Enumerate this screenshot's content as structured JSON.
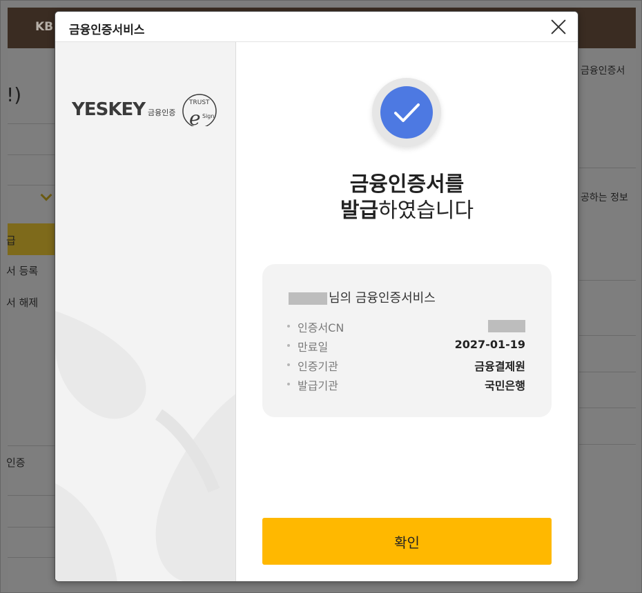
{
  "background": {
    "header_brand": "KB",
    "title_fragment": "!)",
    "menu_issue": "급",
    "menu_register": "서 등록",
    "menu_unregister": "서 해제",
    "menu_auth": "인증",
    "right_label_1": "금융인증서",
    "right_label_2": "공하는 정보"
  },
  "modal": {
    "title": "금융인증서비스",
    "logo": {
      "brand": "YESKEY",
      "brand_sub": "금융인증",
      "seal_top": "TRUST",
      "seal_letter": "e",
      "seal_sub": "Sign"
    },
    "headline_line1": "금융인증서를",
    "headline_bold": "발급",
    "headline_rest": "하였습니다",
    "owner_suffix": "님의 금융인증서비스",
    "info": [
      {
        "label": "인증서CN",
        "value": null
      },
      {
        "label": "만료일",
        "value": "2027-01-19"
      },
      {
        "label": "인증기관",
        "value": "금융결제원"
      },
      {
        "label": "발급기관",
        "value": "국민은행"
      }
    ],
    "confirm_label": "확인"
  },
  "colors": {
    "accent_blue": "#4d79e2",
    "confirm_yellow": "#ffb800",
    "bg_header": "#3a2c22"
  }
}
